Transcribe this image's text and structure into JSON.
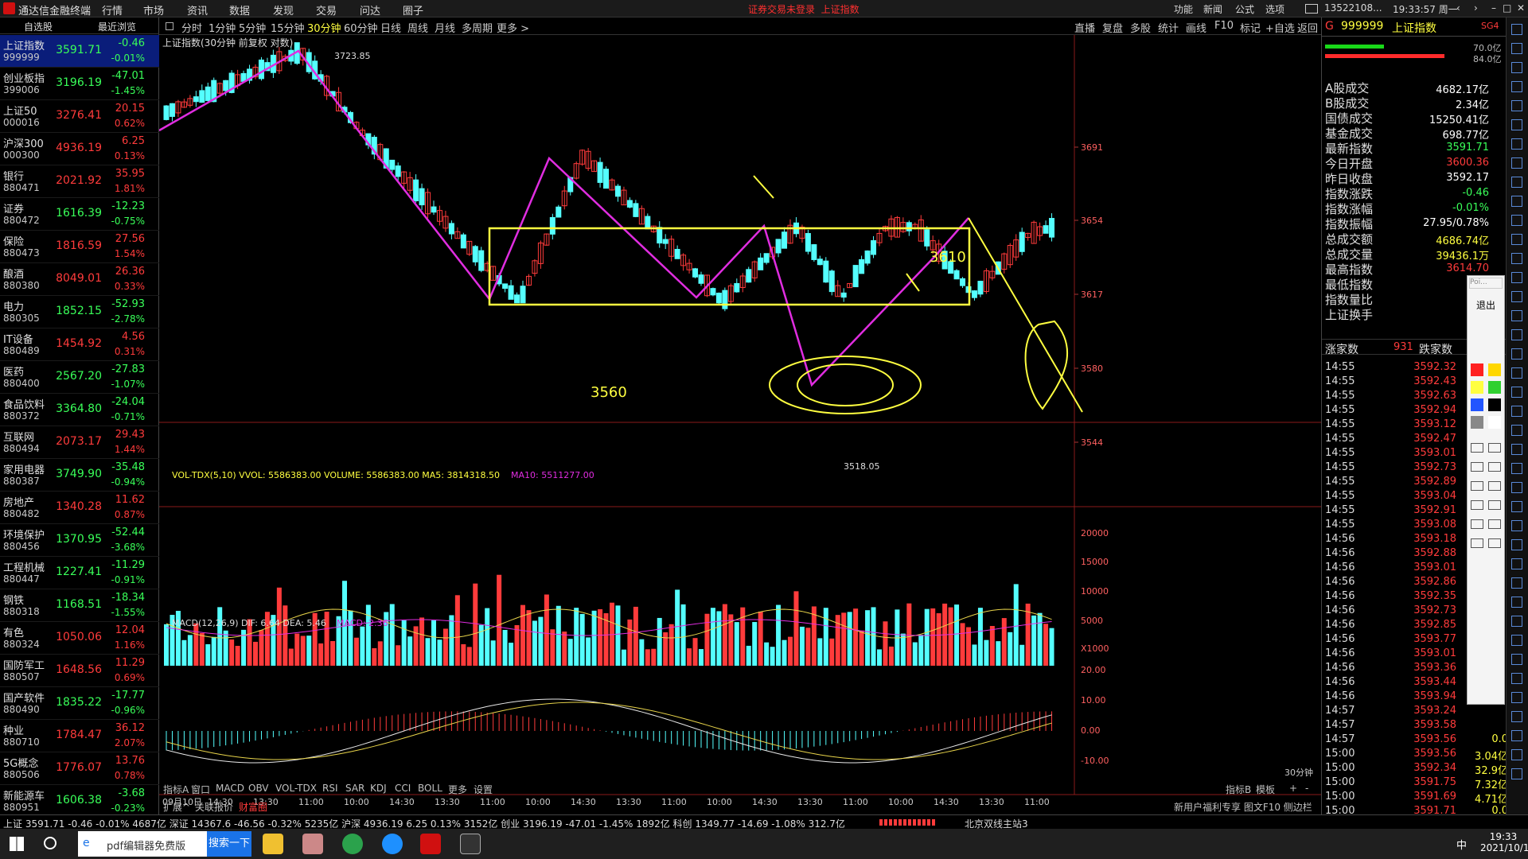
{
  "titlebar": {
    "app_title": "通达信金融终端",
    "menus": [
      "行情",
      "市场",
      "资讯",
      "数据",
      "发现",
      "交易",
      "问达",
      "圈子"
    ],
    "alert": "证券交易未登录",
    "alert_index": "上证指数",
    "right": [
      "功能",
      "新闻",
      "公式",
      "选项"
    ],
    "account": "13522108...",
    "time": "19:33:57 周一"
  },
  "left": {
    "tab1": "自选股",
    "tab2": "最近浏览",
    "rows": [
      {
        "name": "上证指数",
        "code": "999999",
        "price": "3591.71",
        "chg": "-0.46",
        "pct": "-0.01%",
        "pc": "grn",
        "sel": true
      },
      {
        "name": "创业板指",
        "code": "399006",
        "price": "3196.19",
        "chg": "-47.01",
        "pct": "-1.45%",
        "pc": "grn"
      },
      {
        "name": "上证50",
        "code": "000016",
        "price": "3276.41",
        "chg": "20.15",
        "pct": "0.62%",
        "pc": "red"
      },
      {
        "name": "沪深300",
        "code": "000300",
        "price": "4936.19",
        "chg": "6.25",
        "pct": "0.13%",
        "pc": "red"
      },
      {
        "name": "银行",
        "code": "880471",
        "price": "2021.92",
        "chg": "35.95",
        "pct": "1.81%",
        "pc": "red"
      },
      {
        "name": "证券",
        "code": "880472",
        "price": "1616.39",
        "chg": "-12.23",
        "pct": "-0.75%",
        "pc": "grn"
      },
      {
        "name": "保险",
        "code": "880473",
        "price": "1816.59",
        "chg": "27.56",
        "pct": "1.54%",
        "pc": "red"
      },
      {
        "name": "酿酒",
        "code": "880380",
        "price": "8049.01",
        "chg": "26.36",
        "pct": "0.33%",
        "pc": "red"
      },
      {
        "name": "电力",
        "code": "880305",
        "price": "1852.15",
        "chg": "-52.93",
        "pct": "-2.78%",
        "pc": "grn"
      },
      {
        "name": "IT设备",
        "code": "880489",
        "price": "1454.92",
        "chg": "4.56",
        "pct": "0.31%",
        "pc": "red"
      },
      {
        "name": "医药",
        "code": "880400",
        "price": "2567.20",
        "chg": "-27.83",
        "pct": "-1.07%",
        "pc": "grn"
      },
      {
        "name": "食品饮料",
        "code": "880372",
        "price": "3364.80",
        "chg": "-24.04",
        "pct": "-0.71%",
        "pc": "grn"
      },
      {
        "name": "互联网",
        "code": "880494",
        "price": "2073.17",
        "chg": "29.43",
        "pct": "1.44%",
        "pc": "red"
      },
      {
        "name": "家用电器",
        "code": "880387",
        "price": "3749.90",
        "chg": "-35.48",
        "pct": "-0.94%",
        "pc": "grn"
      },
      {
        "name": "房地产",
        "code": "880482",
        "price": "1340.28",
        "chg": "11.62",
        "pct": "0.87%",
        "pc": "red"
      },
      {
        "name": "环境保护",
        "code": "880456",
        "price": "1370.95",
        "chg": "-52.44",
        "pct": "-3.68%",
        "pc": "grn"
      },
      {
        "name": "工程机械",
        "code": "880447",
        "price": "1227.41",
        "chg": "-11.29",
        "pct": "-0.91%",
        "pc": "grn"
      },
      {
        "name": "钢铁",
        "code": "880318",
        "price": "1168.51",
        "chg": "-18.34",
        "pct": "-1.55%",
        "pc": "grn"
      },
      {
        "name": "有色",
        "code": "880324",
        "price": "1050.06",
        "chg": "12.04",
        "pct": "1.16%",
        "pc": "red"
      },
      {
        "name": "国防军工",
        "code": "880507",
        "price": "1648.56",
        "chg": "11.29",
        "pct": "0.69%",
        "pc": "red"
      },
      {
        "name": "国产软件",
        "code": "880490",
        "price": "1835.22",
        "chg": "-17.77",
        "pct": "-0.96%",
        "pc": "grn"
      },
      {
        "name": "种业",
        "code": "880710",
        "price": "1784.47",
        "chg": "36.12",
        "pct": "2.07%",
        "pc": "red"
      },
      {
        "name": "5G概念",
        "code": "880506",
        "price": "1776.07",
        "chg": "13.76",
        "pct": "0.78%",
        "pc": "red"
      },
      {
        "name": "新能源车",
        "code": "880951",
        "price": "1606.38",
        "chg": "-3.68",
        "pct": "-0.23%",
        "pc": "grn"
      }
    ]
  },
  "periods": [
    "分时",
    "1分钟",
    "5分钟",
    "15分钟",
    "30分钟",
    "60分钟",
    "日线",
    "周线",
    "月线",
    "多周期",
    "更多 >"
  ],
  "periods_right": [
    "直播",
    "复盘",
    "多股",
    "统计",
    "画线",
    "F10",
    "标记",
    "+自选",
    "返回"
  ],
  "chart": {
    "caption": "上证指数(30分钟 前复权 对数)",
    "high_label": "3723.85",
    "low_label": "3518.05",
    "hand_a": "3610",
    "hand_b": "3560",
    "price_ticks": [
      "3691",
      "3654",
      "3617",
      "3580",
      "3544"
    ],
    "vol_caption": "VOL-TDX(5,10)  VVOL: 5586383.00  VOLUME: 5586383.00  MA5: 3814318.50",
    "vol_ma10": "MA10: 5511277.00",
    "vol_ticks": [
      "20000",
      "15000",
      "10000",
      "5000",
      "X1000"
    ],
    "macd_caption": "MACD(12,26,9)  DIF: 6.64  DEA: 5.46",
    "macd_val": "MACD: 2.36",
    "macd_ticks": [
      "20.00",
      "10.00",
      "0.00",
      "-10.00"
    ],
    "time_labels": [
      "09月10日",
      "14:30",
      "13:30",
      "11:00",
      "10:00",
      "14:30",
      "13:30",
      "11:00",
      "10:00",
      "14:30",
      "13:30",
      "11:00",
      "10:00",
      "14:30",
      "13:30",
      "11:00",
      "10:00",
      "14:30",
      "13:30",
      "11:00"
    ],
    "period_tag": "30分钟",
    "bottom_tabs": [
      "指标A",
      "窗口",
      "MACD",
      "OBV",
      "VOL-TDX",
      "RSI",
      "SAR",
      "KDJ",
      "CCI",
      "BOLL",
      "更多",
      "设置"
    ],
    "bottom2": [
      "扩展^",
      "关联报价",
      "财富圈"
    ],
    "bottom_right": [
      "指标B",
      "模板",
      "+",
      "-"
    ]
  },
  "right": {
    "code": "999999",
    "name": "上证指数",
    "tag": "SG4",
    "bar1": "70.0亿",
    "bar2": "84.0亿",
    "stats": [
      {
        "l": "A股成交",
        "v": "4682.17亿",
        "c": "wht"
      },
      {
        "l": "B股成交",
        "v": "2.34亿",
        "c": "wht"
      },
      {
        "l": "国债成交",
        "v": "15250.41亿",
        "c": "wht"
      },
      {
        "l": "基金成交",
        "v": "698.77亿",
        "c": "wht"
      },
      {
        "l": "最新指数",
        "v": "3591.71",
        "c": "grn"
      },
      {
        "l": "今日开盘",
        "v": "3600.36",
        "c": "red"
      },
      {
        "l": "昨日收盘",
        "v": "3592.17",
        "c": "wht"
      },
      {
        "l": "指数涨跌",
        "v": "-0.46",
        "c": "grn"
      },
      {
        "l": "指数涨幅",
        "v": "-0.01%",
        "c": "grn"
      },
      {
        "l": "指数振幅",
        "v": "27.95/0.78%",
        "c": "wht"
      },
      {
        "l": "总成交额",
        "v": "4686.74亿",
        "c": "yel"
      },
      {
        "l": "总成交量",
        "v": "39436.1万",
        "c": "yel"
      },
      {
        "l": "最高指数",
        "v": "3614.70",
        "c": "red"
      },
      {
        "l": "最低指数",
        "v": "",
        "c": "grn"
      },
      {
        "l": "指数量比",
        "v": "",
        "c": "wht"
      },
      {
        "l": "上证换手",
        "v": "",
        "c": "wht"
      }
    ],
    "up_label": "涨家数",
    "up": "931",
    "down_label": "跌家数",
    "ticks": [
      [
        "14:55",
        "3592.32",
        ""
      ],
      [
        "14:55",
        "3592.43",
        ""
      ],
      [
        "14:55",
        "3592.63",
        ""
      ],
      [
        "14:55",
        "3592.94",
        ""
      ],
      [
        "14:55",
        "3593.12",
        ""
      ],
      [
        "14:55",
        "3592.47",
        ""
      ],
      [
        "14:55",
        "3593.01",
        ""
      ],
      [
        "14:55",
        "3592.73",
        ""
      ],
      [
        "14:55",
        "3592.89",
        ""
      ],
      [
        "14:55",
        "3593.04",
        ""
      ],
      [
        "14:55",
        "3592.91",
        ""
      ],
      [
        "14:55",
        "3593.08",
        ""
      ],
      [
        "14:56",
        "3593.18",
        ""
      ],
      [
        "14:56",
        "3592.88",
        ""
      ],
      [
        "14:56",
        "3593.01",
        ""
      ],
      [
        "14:56",
        "3592.86",
        ""
      ],
      [
        "14:56",
        "3592.35",
        ""
      ],
      [
        "14:56",
        "3592.73",
        ""
      ],
      [
        "14:56",
        "3592.85",
        ""
      ],
      [
        "14:56",
        "3593.77",
        ""
      ],
      [
        "14:56",
        "3593.01",
        ""
      ],
      [
        "14:56",
        "3593.36",
        ""
      ],
      [
        "14:56",
        "3593.44",
        ""
      ],
      [
        "14:56",
        "3593.94",
        ""
      ],
      [
        "14:57",
        "3593.24",
        ""
      ],
      [
        "14:57",
        "3593.58",
        ""
      ],
      [
        "14:57",
        "3593.56",
        "0.0"
      ],
      [
        "15:00",
        "3593.56",
        "3.04亿"
      ],
      [
        "15:00",
        "3592.34",
        "32.9亿"
      ],
      [
        "15:00",
        "3591.75",
        "7.32亿"
      ],
      [
        "15:00",
        "3591.69",
        "4.71亿"
      ],
      [
        "15:00",
        "3591.71",
        "0.0"
      ]
    ],
    "draw_exit": "退出",
    "draw_poi": "Poi..."
  },
  "status": {
    "text": "上证 3591.71  -0.46  -0.01%  4687亿  深证 14367.6  -46.56  -0.32%  5235亿  沪深 4936.19  6.25  0.13%  3152亿  创业 3196.19  -47.01  -1.45%  1892亿  科创 1349.77  -14.69  -1.08%  312.7亿",
    "server": "北京双线主站3",
    "rbar": "新用户福利专享  图文F10  侧边栏"
  },
  "taskbar": {
    "search_placeholder": "pdf编辑器免费版",
    "search_btn": "搜索一下",
    "time": "19:33",
    "date": "2021/10/11",
    "ime": "中"
  },
  "colors": {
    "up": "#ff3b3b",
    "down": "#54ffff",
    "zigzag": "#e02de0",
    "hand": "#ffff40",
    "dif": "#e8e8e8",
    "dea": "#e8d44a"
  }
}
